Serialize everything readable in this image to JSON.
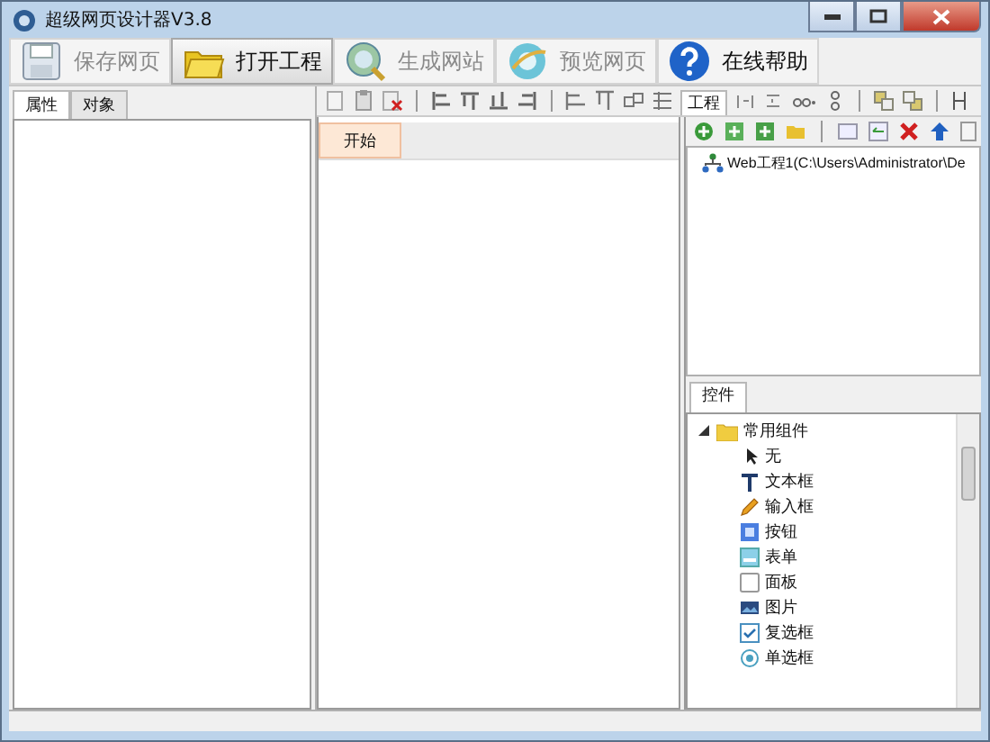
{
  "window": {
    "title": "超级网页设计器V3.8"
  },
  "toolbar": [
    {
      "kind": "save",
      "label": "保存网页",
      "disabled": true,
      "hovered": false
    },
    {
      "kind": "open",
      "label": "打开工程",
      "disabled": false,
      "hovered": true
    },
    {
      "kind": "build",
      "label": "生成网站",
      "disabled": true,
      "hovered": false
    },
    {
      "kind": "preview",
      "label": "预览网页",
      "disabled": true,
      "hovered": false
    },
    {
      "kind": "help",
      "label": "在线帮助",
      "disabled": false,
      "hovered": false
    }
  ],
  "left_panel": {
    "tabs": [
      {
        "label": "属性",
        "selected": true
      },
      {
        "label": "对象",
        "selected": false
      }
    ]
  },
  "design_tabs": [
    {
      "label": "开始",
      "selected": true
    }
  ],
  "project_panel": {
    "tab": "工程",
    "tree": [
      {
        "label": "Web工程1(C:\\Users\\Administrator\\De"
      }
    ]
  },
  "controls_panel": {
    "tab": "控件",
    "tree": [
      {
        "label": "常用组件",
        "expanded": true,
        "children": [
          {
            "kind": "pointer",
            "label": "无"
          },
          {
            "kind": "text",
            "label": "文本框"
          },
          {
            "kind": "input",
            "label": "输入框"
          },
          {
            "kind": "button",
            "label": "按钮"
          },
          {
            "kind": "form",
            "label": "表单"
          },
          {
            "kind": "panel",
            "label": "面板"
          },
          {
            "kind": "image",
            "label": "图片"
          },
          {
            "kind": "checkbox",
            "label": "复选框"
          },
          {
            "kind": "radio",
            "label": "单选框"
          }
        ]
      }
    ]
  }
}
